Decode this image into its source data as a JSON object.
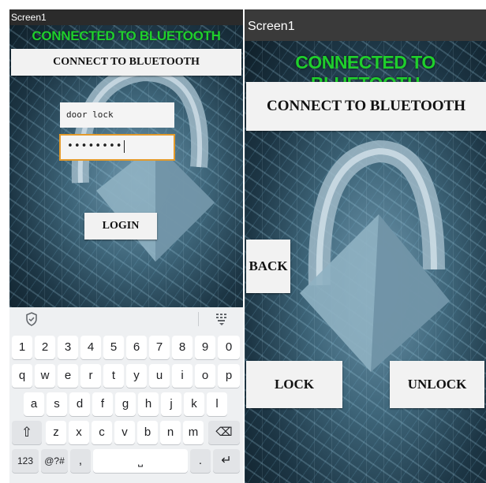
{
  "left_screen": {
    "window_title": "Screen1",
    "status_title": "CONNECTED TO BLUETOOTH",
    "connect_button": "CONNECT TO BLUETOOTH",
    "username_value": "door lock",
    "password_value": "••••••••",
    "login_button": "LOGIN"
  },
  "keyboard": {
    "toolbar_icons": [
      "shield-icon",
      "keyboard-hide-icon"
    ],
    "row_numbers": [
      "1",
      "2",
      "3",
      "4",
      "5",
      "6",
      "7",
      "8",
      "9",
      "0"
    ],
    "row_top": [
      "q",
      "w",
      "e",
      "r",
      "t",
      "y",
      "u",
      "i",
      "o",
      "p"
    ],
    "row_home": [
      "a",
      "s",
      "d",
      "f",
      "g",
      "h",
      "j",
      "k",
      "l"
    ],
    "row_bottom": [
      "z",
      "x",
      "c",
      "v",
      "b",
      "n",
      "m"
    ],
    "shift_glyph": "⇧",
    "backspace_glyph": "⌫",
    "mode_key": "123",
    "symbols_key": "@?#",
    "comma_key": ",",
    "space_glyph": "⎵",
    "period_key": ".",
    "enter_glyph": "↵"
  },
  "right_screen": {
    "window_title": "Screen1",
    "status_title": "CONNECTED TO BLUETOOTH",
    "connect_button": "CONNECT TO BLUETOOTH",
    "back_button": "BACK",
    "lock_button": "LOCK",
    "unlock_button": "UNLOCK"
  },
  "colors": {
    "status_green": "#1fcf2c",
    "focus_orange": "#e39a2b",
    "button_white": "#f2f2f2"
  }
}
